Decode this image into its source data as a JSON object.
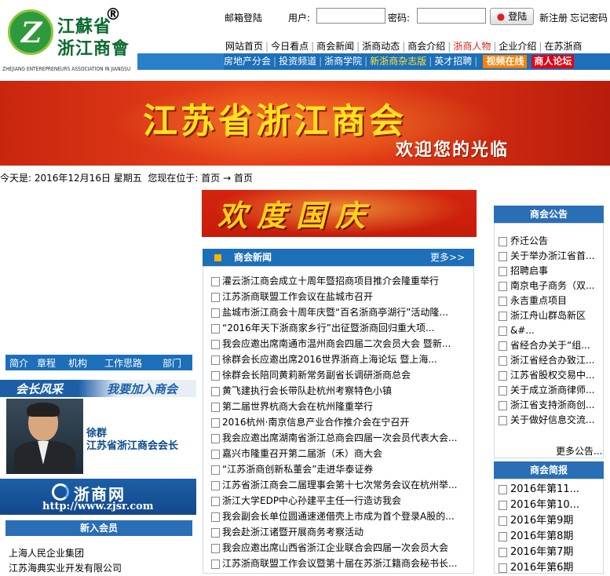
{
  "logo": {
    "cn_line1": "江蘇省",
    "cn_line2": "浙江商會",
    "registered": "®",
    "en": "ZHEJIANG ENTEREPRENEURS ASSOCIATION IN JIANGSU"
  },
  "login": {
    "mail_login": "邮箱登陆",
    "user_label": "用户:",
    "password_label": "密码:",
    "login_button": "登陆",
    "register": "新注册",
    "forgot": "忘记密码"
  },
  "nav_top": [
    "网站首页",
    "今日看点",
    "商会新闻",
    "浙商动态",
    "商会介绍",
    "浙商人物",
    "企业介绍",
    "在苏浙商"
  ],
  "nav_bottom": [
    "房地产分会",
    "投资频道",
    "浙商学院",
    "新浙商杂志版",
    "英才招聘"
  ],
  "nav_video": "视频在线",
  "nav_forum": "商人论坛",
  "banner": {
    "title": "江苏省浙江商会",
    "welcome": "欢迎您的光临"
  },
  "dateline": {
    "today_label": "今天是:",
    "date": "2016年12月16日 星期五",
    "location_label": "您现在位于:",
    "crumb1": "首页",
    "arrow": "→",
    "crumb2": "首页"
  },
  "left_nav": [
    "简介",
    "章程",
    "机构",
    "工作思路",
    "部门"
  ],
  "president": {
    "tab_a": "会长风采",
    "tab_b": "我要加入商会",
    "name": "徐群",
    "title": "江苏省浙江商会会长"
  },
  "zjsr": {
    "name": "浙商网",
    "url": "http://www.zjsr.com"
  },
  "new_members": {
    "header": "新入会员",
    "items": [
      "上海人民企业集团",
      "江苏海典实业开发有限公司"
    ]
  },
  "guoqing": "欢度国庆",
  "news": {
    "header": "商会新闻",
    "more": "更多>>",
    "items": [
      "灌云浙江商会成立十周年暨招商项目推介会隆重举行",
      "江苏浙商联盟工作会议在盐城市召开",
      "盐城市浙江商会十周年庆暨“百名浙商亭湖行”活动隆...",
      "“2016年天下浙商家乡行”出征暨浙商回归重大项...",
      "我会应邀出席南通市温州商会四届二次会员大会 暨新...",
      "徐群会长应邀出席2016世界浙商上海论坛 暨上海...",
      "徐群会长陪同黄莉新常务副省长调研浙商总会",
      "黄飞建执行会长带队赴杭州考察特色小镇",
      "第二届世界杭商大会在杭州隆重举行",
      "2016杭州·南京信息产业合作推介会在宁召开",
      "我会应邀出席湖南省浙江总商会四届一次会员代表大会...",
      "嘉兴市隆重召开第二届浙（禾）商大会",
      "“江苏浙商创新私董会”走进华泰证券",
      "江苏省浙江商会二届理事会第十七次常务会议在杭州举...",
      "浙江大学EDP中心孙建平主任一行造访我会",
      "我会副会长单位圆通速递借壳上市成为首个登录A股的...",
      "我会赴浙江诸暨开展商务考察活动",
      "我会应邀出席山西省浙江企业联合会四届一次会员大会",
      "江苏浙商联盟工作会议暨第十届在苏浙江籍商会秘书长..."
    ]
  },
  "notices": {
    "header": "商会公告",
    "items": [
      "乔迁公告",
      "关于举办浙江省首...",
      "招聘启事",
      "南京电子商务（双...",
      "永吉重点项目",
      "浙江舟山群岛新区",
      "&#...",
      "省经合办关于“组...",
      "浙江省经合办致江...",
      "江苏省股权交易中...",
      "关于成立浙商律师...",
      "浙江省支持浙商创...",
      "关于做好信息交流..."
    ],
    "more": "更多公告..."
  },
  "journal": {
    "header": "商会简报",
    "items": [
      "2016年第11...",
      "2016年第10...",
      "2016年第9期",
      "2016年第8期",
      "2016年第7期",
      "2016年第6期"
    ]
  }
}
